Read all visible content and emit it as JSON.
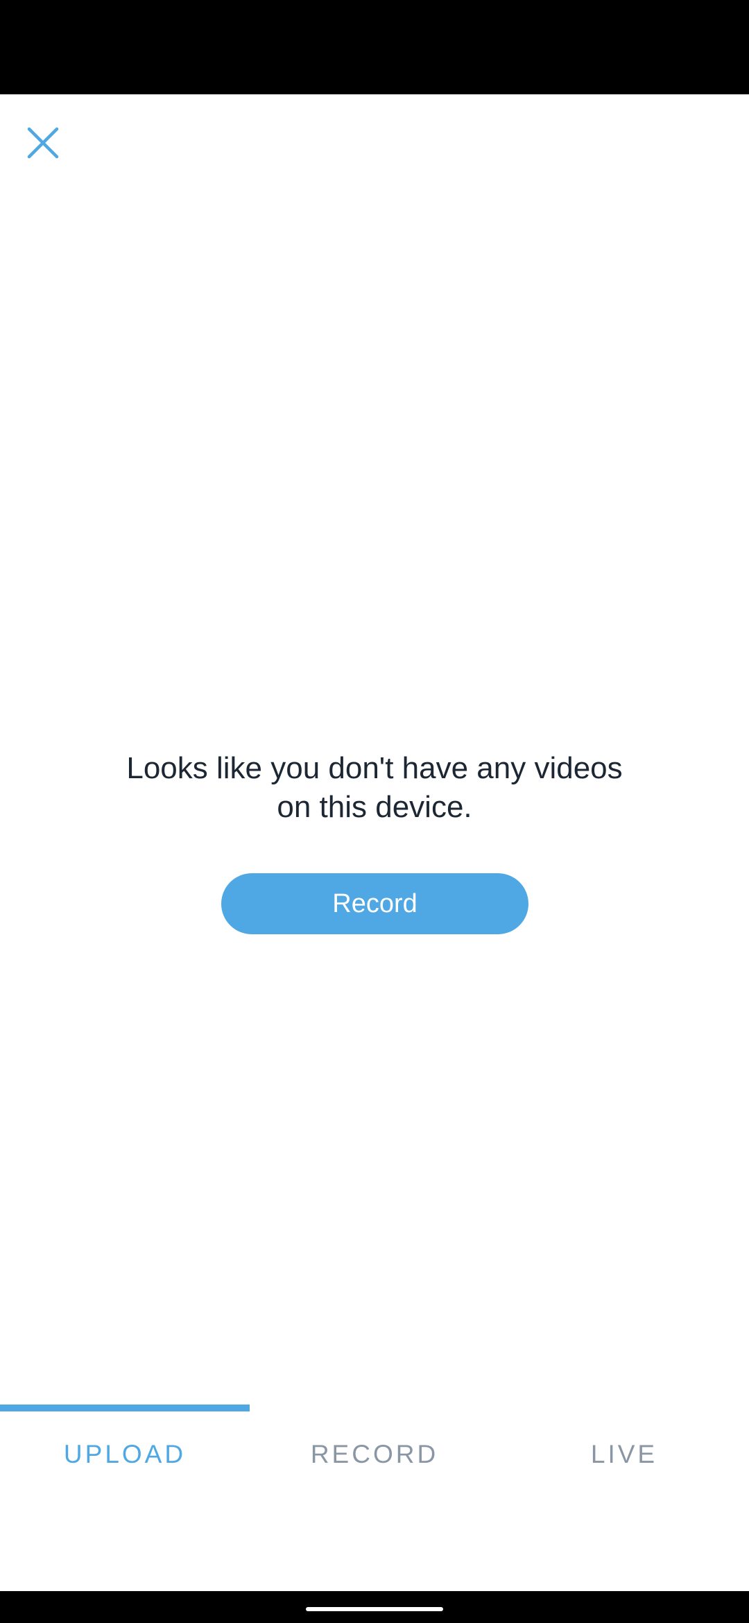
{
  "header": {
    "close_icon": "close-icon",
    "accent_color": "#4fa8e3"
  },
  "empty_state": {
    "message": "Looks like you don't have any videos on this device.",
    "record_button_label": "Record"
  },
  "tabs": [
    {
      "label": "UPLOAD",
      "active": true
    },
    {
      "label": "RECORD",
      "active": false
    },
    {
      "label": "LIVE",
      "active": false
    }
  ]
}
